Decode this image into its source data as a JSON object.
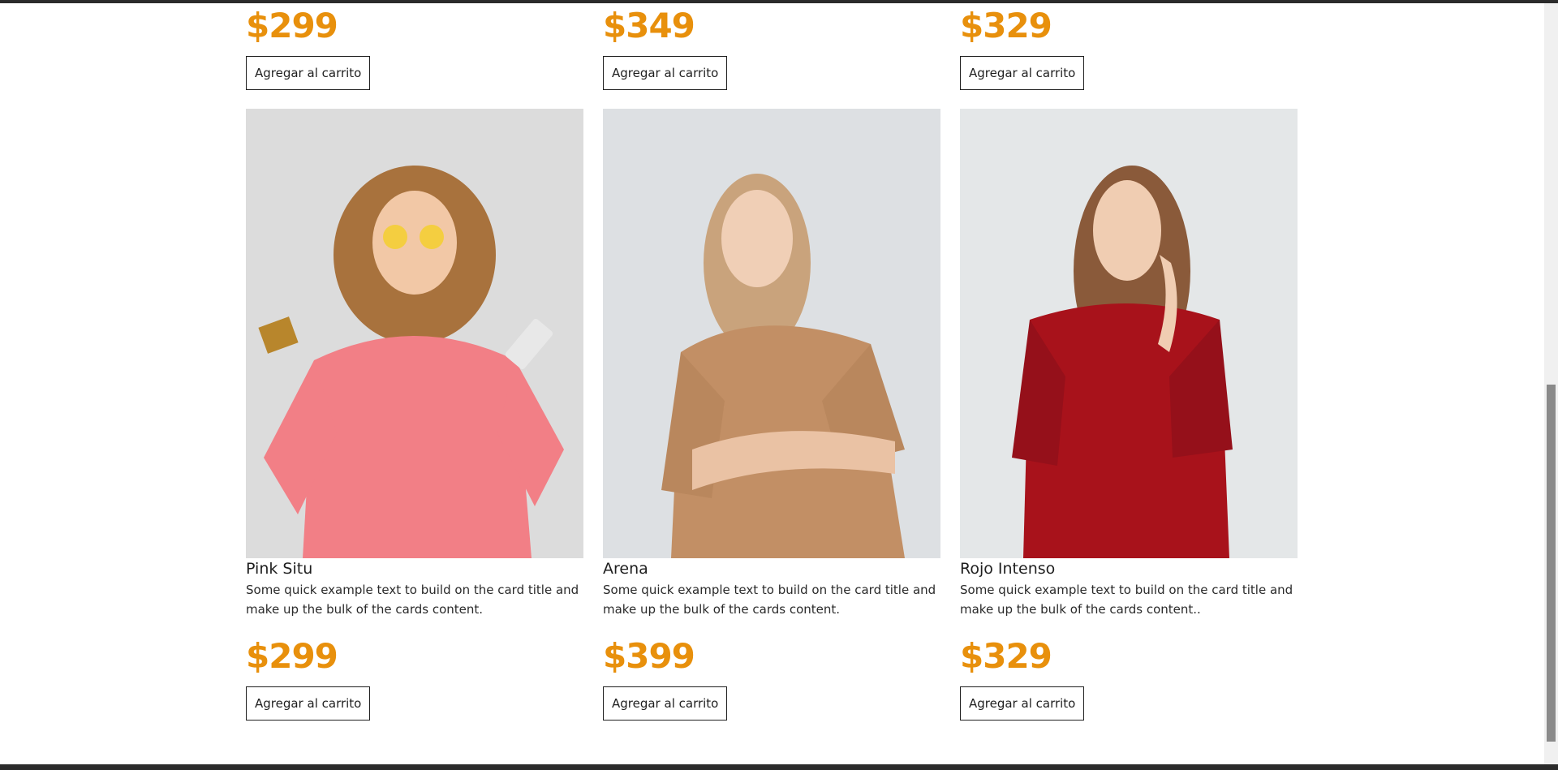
{
  "previous_row": [
    {
      "price": "$299",
      "button_label": "Agregar al carrito"
    },
    {
      "price": "$349",
      "button_label": "Agregar al carrito"
    },
    {
      "price": "$329",
      "button_label": "Agregar al carrito"
    }
  ],
  "products": [
    {
      "title": "Pink Situ",
      "description": "Some quick example text to build on the card title and make up the bulk of the cards content.",
      "price": "$299",
      "button_label": "Agregar al carrito",
      "image_icon": "product-photo-pink-hoodie",
      "garment_color": "#f27f86",
      "bg_color": "#dcdcdc"
    },
    {
      "title": "Arena",
      "description": "Some quick example text to build on the card title and make up the bulk of the cards content.",
      "price": "$399",
      "button_label": "Agregar al carrito",
      "image_icon": "product-photo-sand-sweatshirt",
      "garment_color": "#c28f65",
      "bg_color": "#dde0e3"
    },
    {
      "title": "Rojo Intenso",
      "description": "Some quick example text to build on the card title and make up the bulk of the cards content..",
      "price": "$329",
      "button_label": "Agregar al carrito",
      "image_icon": "product-photo-red-sweater",
      "garment_color": "#a8121b",
      "bg_color": "#e4e7e8"
    }
  ],
  "colors": {
    "price_accent": "#e8900c",
    "text": "#1f1f1f",
    "frame": "#2b2b2b"
  }
}
